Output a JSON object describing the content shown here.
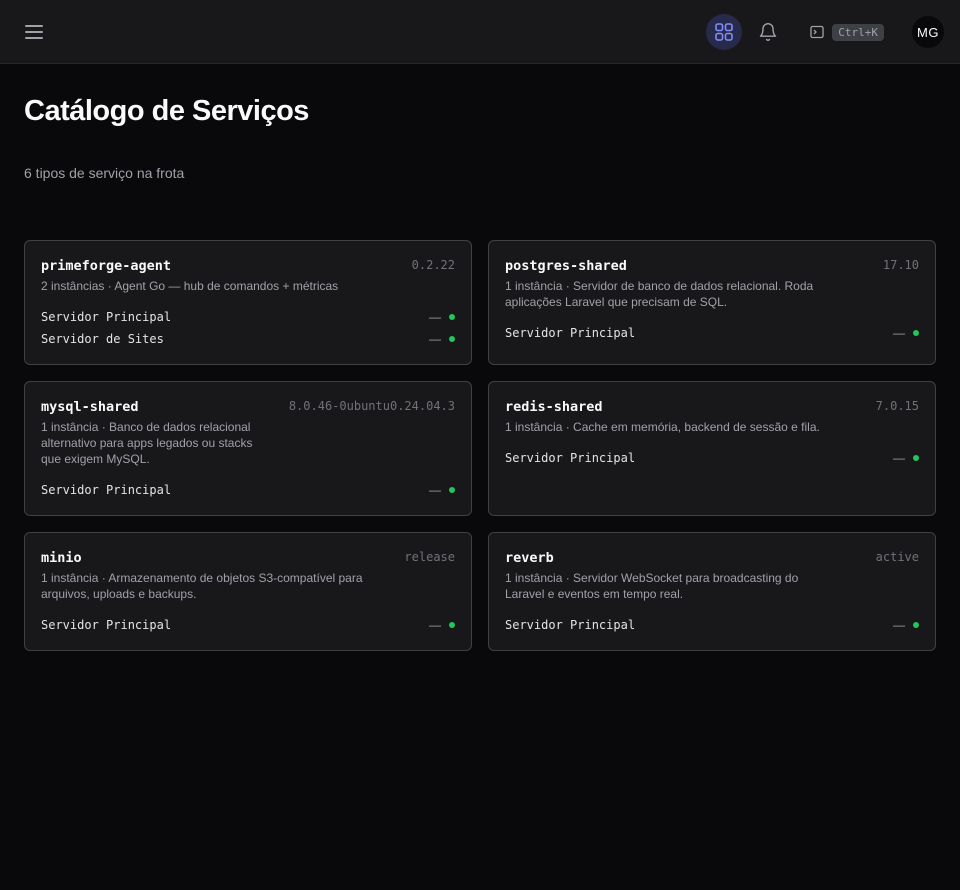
{
  "header": {
    "shortcut": "Ctrl+K",
    "avatar_initials": "MG",
    "accent": "#818cf8"
  },
  "page": {
    "title": "Catálogo de Serviços",
    "subtitle": "6 tipos de serviço na frota"
  },
  "status_color": "#22c55e",
  "services": [
    {
      "name": "primeforge-agent",
      "version": "0.2.22",
      "description": "2 instâncias · Agent Go — hub de comandos + métricas",
      "servers": [
        {
          "name": "Servidor Principal",
          "status": "—"
        },
        {
          "name": "Servidor de Sites",
          "status": "—"
        }
      ]
    },
    {
      "name": "postgres-shared",
      "version": "17.10",
      "description": "1 instância · Servidor de banco de dados relacional. Roda aplicações Laravel que precisam de SQL.",
      "servers": [
        {
          "name": "Servidor Principal",
          "status": "—"
        }
      ]
    },
    {
      "name": "mysql-shared",
      "version": "8.0.46-0ubuntu0.24.04.3",
      "description": "1 instância · Banco de dados relacional alternativo para apps legados ou stacks que exigem MySQL.",
      "servers": [
        {
          "name": "Servidor Principal",
          "status": "—"
        }
      ]
    },
    {
      "name": "redis-shared",
      "version": "7.0.15",
      "description": "1 instância · Cache em memória, backend de sessão e fila.",
      "servers": [
        {
          "name": "Servidor Principal",
          "status": "—"
        }
      ]
    },
    {
      "name": "minio",
      "version": "release",
      "description": "1 instância · Armazenamento de objetos S3-compatível para arquivos, uploads e backups.",
      "servers": [
        {
          "name": "Servidor Principal",
          "status": "—"
        }
      ]
    },
    {
      "name": "reverb",
      "version": "active",
      "description": "1 instância · Servidor WebSocket para broadcasting do Laravel e eventos em tempo real.",
      "servers": [
        {
          "name": "Servidor Principal",
          "status": "—"
        }
      ]
    }
  ]
}
